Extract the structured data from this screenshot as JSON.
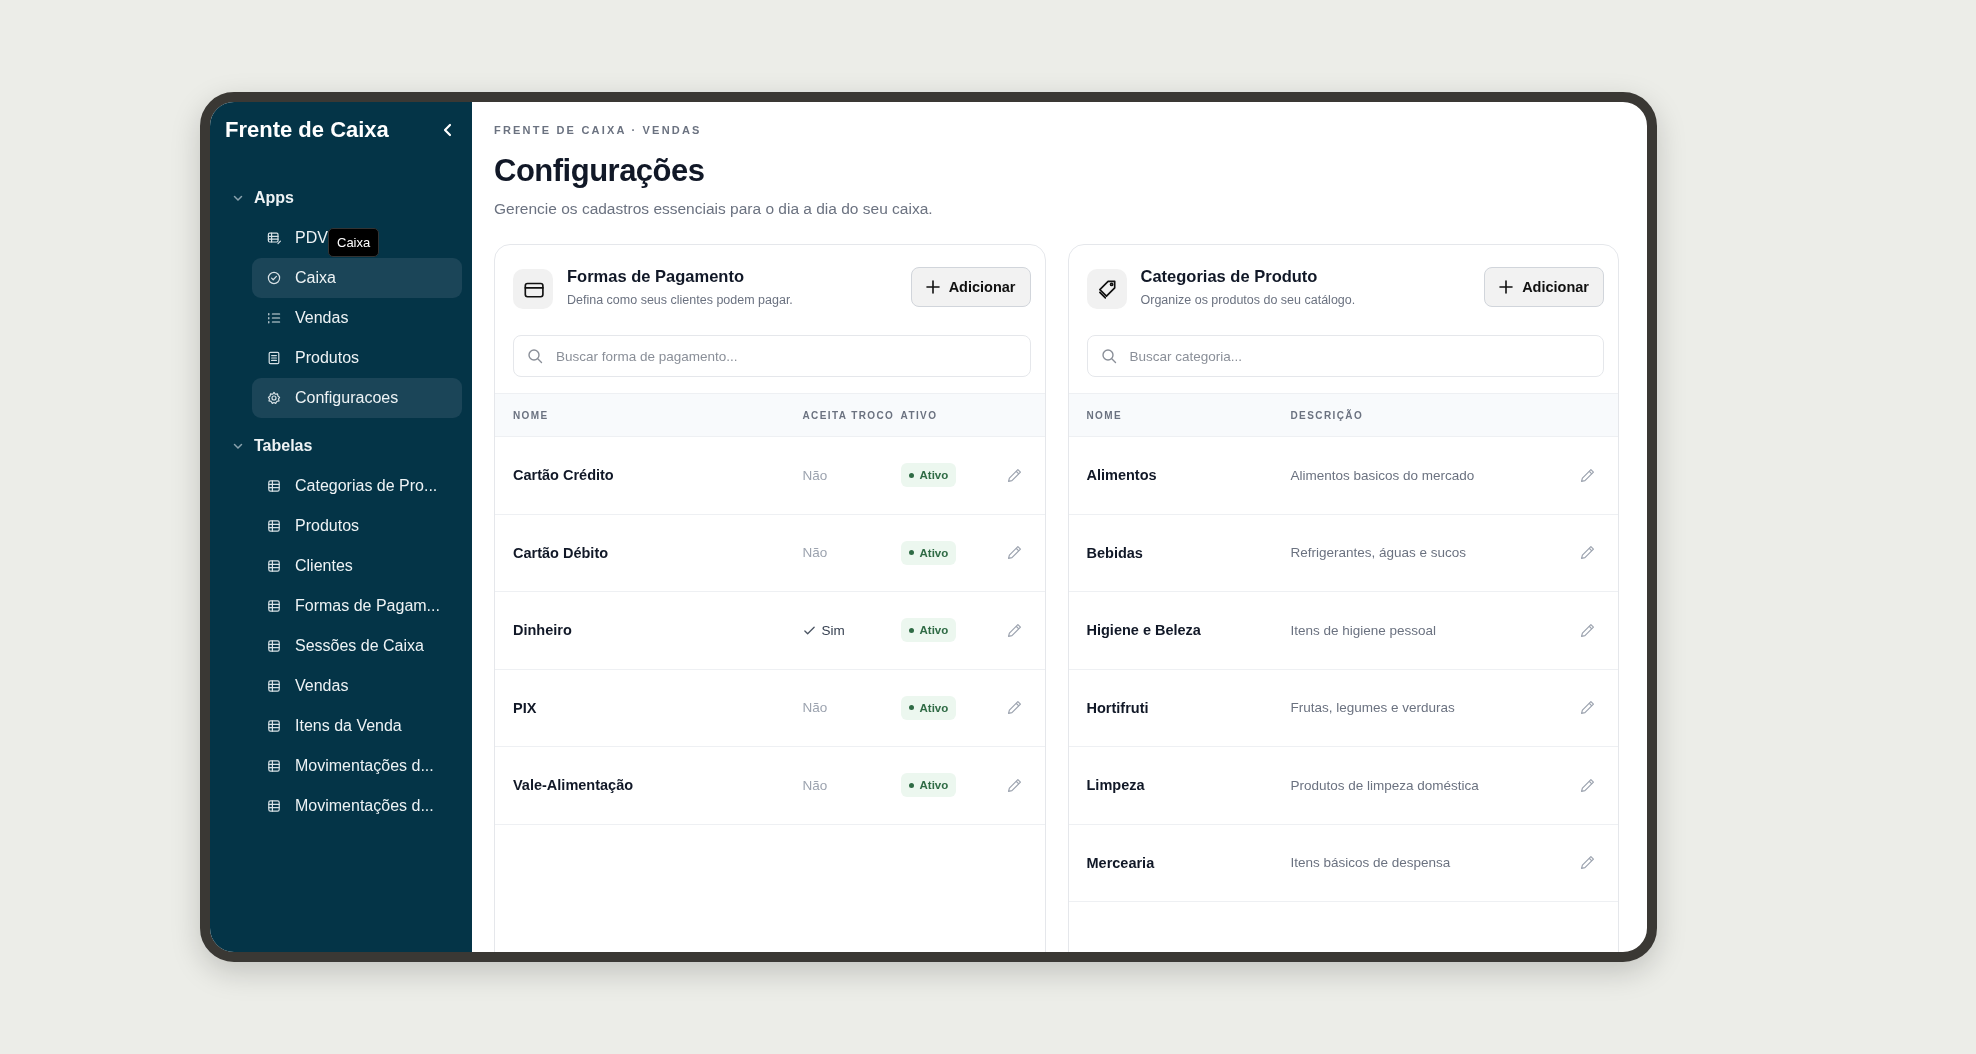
{
  "sidebar": {
    "title": "Frente de Caixa",
    "tooltip": "Caixa",
    "groups": [
      {
        "label": "Apps",
        "expanded": true,
        "items": [
          {
            "label": "PDV",
            "kind": "table-edit",
            "selected": false
          },
          {
            "label": "Caixa",
            "kind": "check-circle",
            "selected": true
          },
          {
            "label": "Vendas",
            "kind": "list",
            "selected": false
          },
          {
            "label": "Produtos",
            "kind": "document",
            "selected": false
          },
          {
            "label": "Configuracoes",
            "kind": "gear",
            "selected": true
          }
        ]
      },
      {
        "label": "Tabelas",
        "expanded": true,
        "items": [
          {
            "label": "Categorias de Pro...",
            "kind": "table",
            "selected": false
          },
          {
            "label": "Produtos",
            "kind": "table",
            "selected": false
          },
          {
            "label": "Clientes",
            "kind": "table",
            "selected": false
          },
          {
            "label": "Formas de Pagam...",
            "kind": "table",
            "selected": false
          },
          {
            "label": "Sessões de Caixa",
            "kind": "table",
            "selected": false
          },
          {
            "label": "Vendas",
            "kind": "table",
            "selected": false
          },
          {
            "label": "Itens da Venda",
            "kind": "table",
            "selected": false
          },
          {
            "label": "Movimentações d...",
            "kind": "table",
            "selected": false
          },
          {
            "label": "Movimentações d...",
            "kind": "table",
            "selected": false
          }
        ]
      }
    ]
  },
  "page": {
    "breadcrumb": "FRENTE DE CAIXA · VENDAS",
    "title": "Configurações",
    "subtitle": "Gerencie os cadastros essenciais para o dia a dia do seu caixa."
  },
  "cards": [
    {
      "kind": "payments",
      "title": "Formas de Pagamento",
      "subtitle": "Defina como seus clientes podem pagar.",
      "add_button": "Adicionar",
      "search": {
        "placeholder": "Buscar forma de pagamento..."
      },
      "columns": [
        "NOME",
        "ACEITA TROCO",
        "ATIVO"
      ],
      "rows": [
        {
          "name": "Cartão Crédito",
          "accepts_change": false,
          "change_text": "Não",
          "active": true,
          "status": "Ativo"
        },
        {
          "name": "Cartão Débito",
          "accepts_change": false,
          "change_text": "Não",
          "active": true,
          "status": "Ativo"
        },
        {
          "name": "Dinheiro",
          "accepts_change": true,
          "change_text": "Sim",
          "active": true,
          "status": "Ativo"
        },
        {
          "name": "PIX",
          "accepts_change": false,
          "change_text": "Não",
          "active": true,
          "status": "Ativo"
        },
        {
          "name": "Vale-Alimentação",
          "accepts_change": false,
          "change_text": "Não",
          "active": true,
          "status": "Ativo"
        }
      ]
    },
    {
      "kind": "categories",
      "title": "Categorias de Produto",
      "subtitle": "Organize os produtos do seu catálogo.",
      "add_button": "Adicionar",
      "search": {
        "placeholder": "Buscar categoria..."
      },
      "columns": [
        "NOME",
        "DESCRIÇÃO"
      ],
      "rows": [
        {
          "name": "Alimentos",
          "description": "Alimentos basicos do mercado"
        },
        {
          "name": "Bebidas",
          "description": "Refrigerantes, águas e sucos"
        },
        {
          "name": "Higiene e Beleza",
          "description": "Itens de higiene pessoal"
        },
        {
          "name": "Hortifruti",
          "description": "Frutas, legumes e verduras"
        },
        {
          "name": "Limpeza",
          "description": "Produtos de limpeza doméstica"
        },
        {
          "name": "Mercearia",
          "description": "Itens básicos de despensa"
        }
      ]
    }
  ]
}
